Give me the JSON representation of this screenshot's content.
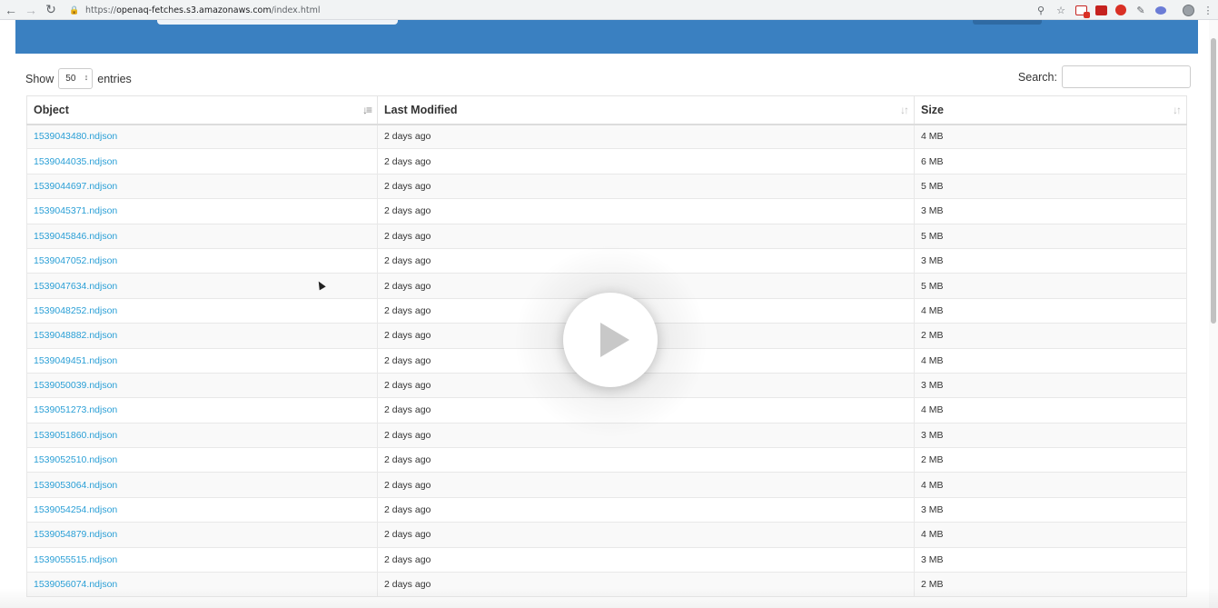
{
  "browser": {
    "url_prefix": "https://",
    "url_host": "openaq-fetches.s3.amazonaws.com",
    "url_path": "/index.html",
    "zoom_icon": "magnifier-icon",
    "star_icon": "star-icon",
    "menu_glyph": "⋮"
  },
  "controls": {
    "show_label": "Show",
    "entries_value": "50",
    "entries_label": "entries",
    "search_label": "Search:",
    "search_value": ""
  },
  "table": {
    "columns": [
      "Object",
      "Last Modified",
      "Size"
    ],
    "rows": [
      {
        "object": "1539043480.ndjson",
        "modified": "2 days ago",
        "size": "4 MB"
      },
      {
        "object": "1539044035.ndjson",
        "modified": "2 days ago",
        "size": "6 MB"
      },
      {
        "object": "1539044697.ndjson",
        "modified": "2 days ago",
        "size": "5 MB"
      },
      {
        "object": "1539045371.ndjson",
        "modified": "2 days ago",
        "size": "3 MB"
      },
      {
        "object": "1539045846.ndjson",
        "modified": "2 days ago",
        "size": "5 MB"
      },
      {
        "object": "1539047052.ndjson",
        "modified": "2 days ago",
        "size": "3 MB"
      },
      {
        "object": "1539047634.ndjson",
        "modified": "2 days ago",
        "size": "5 MB"
      },
      {
        "object": "1539048252.ndjson",
        "modified": "2 days ago",
        "size": "4 MB"
      },
      {
        "object": "1539048882.ndjson",
        "modified": "2 days ago",
        "size": "2 MB"
      },
      {
        "object": "1539049451.ndjson",
        "modified": "2 days ago",
        "size": "4 MB"
      },
      {
        "object": "1539050039.ndjson",
        "modified": "2 days ago",
        "size": "3 MB"
      },
      {
        "object": "1539051273.ndjson",
        "modified": "2 days ago",
        "size": "4 MB"
      },
      {
        "object": "1539051860.ndjson",
        "modified": "2 days ago",
        "size": "3 MB"
      },
      {
        "object": "1539052510.ndjson",
        "modified": "2 days ago",
        "size": "2 MB"
      },
      {
        "object": "1539053064.ndjson",
        "modified": "2 days ago",
        "size": "4 MB"
      },
      {
        "object": "1539054254.ndjson",
        "modified": "2 days ago",
        "size": "3 MB"
      },
      {
        "object": "1539054879.ndjson",
        "modified": "2 days ago",
        "size": "4 MB"
      },
      {
        "object": "1539055515.ndjson",
        "modified": "2 days ago",
        "size": "3 MB"
      },
      {
        "object": "1539056074.ndjson",
        "modified": "2 days ago",
        "size": "2 MB"
      }
    ]
  },
  "colors": {
    "banner": "#3a80c1",
    "link": "#2a9fd6"
  },
  "overlay": {
    "play_icon": "play-icon"
  }
}
